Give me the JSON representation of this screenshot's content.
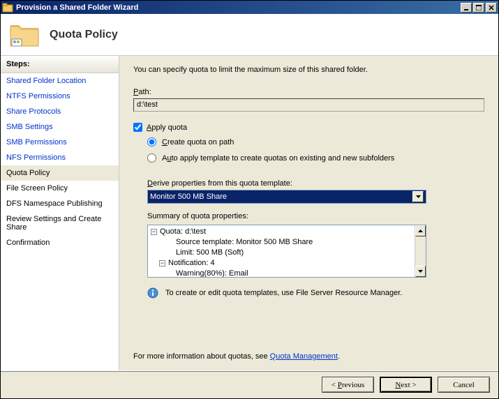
{
  "window": {
    "title": "Provision a Shared Folder Wizard"
  },
  "header": {
    "title": "Quota Policy"
  },
  "sidebar": {
    "heading": "Steps:",
    "items": [
      {
        "label": "Shared Folder Location",
        "state": "done"
      },
      {
        "label": "NTFS Permissions",
        "state": "done"
      },
      {
        "label": "Share Protocols",
        "state": "done"
      },
      {
        "label": "SMB Settings",
        "state": "done"
      },
      {
        "label": "SMB Permissions",
        "state": "done"
      },
      {
        "label": "NFS Permissions",
        "state": "done"
      },
      {
        "label": "Quota Policy",
        "state": "current"
      },
      {
        "label": "File Screen Policy",
        "state": "pending"
      },
      {
        "label": "DFS Namespace Publishing",
        "state": "pending"
      },
      {
        "label": "Review Settings and Create Share",
        "state": "pending"
      },
      {
        "label": "Confirmation",
        "state": "pending"
      }
    ]
  },
  "content": {
    "intro": "You can specify quota to limit the maximum size of this shared folder.",
    "path_label": "Path:",
    "path_value": "d:\\test",
    "apply_quota_label": "Apply quota",
    "apply_quota_checked": true,
    "radio_create_label": "Create quota on path",
    "radio_auto_label": "Auto apply template to create quotas on existing and new subfolders",
    "radio_selected": "create",
    "derive_label": "Derive properties from this quota template:",
    "template_selected": "Monitor 500 MB Share",
    "summary_label": "Summary of quota properties:",
    "summary_tree": {
      "root": "Quota: d:\\test",
      "source": "Source template: Monitor 500 MB Share",
      "limit": "Limit: 500 MB (Soft)",
      "notification": "Notification: 4",
      "warning": "Warning(80%): Email"
    },
    "info_text": "To create or edit quota templates, use File Server Resource Manager.",
    "more_prefix": "For more information about quotas, see ",
    "more_link": "Quota Management",
    "more_suffix": "."
  },
  "footer": {
    "previous": "< Previous",
    "next": "Next >",
    "cancel": "Cancel"
  }
}
